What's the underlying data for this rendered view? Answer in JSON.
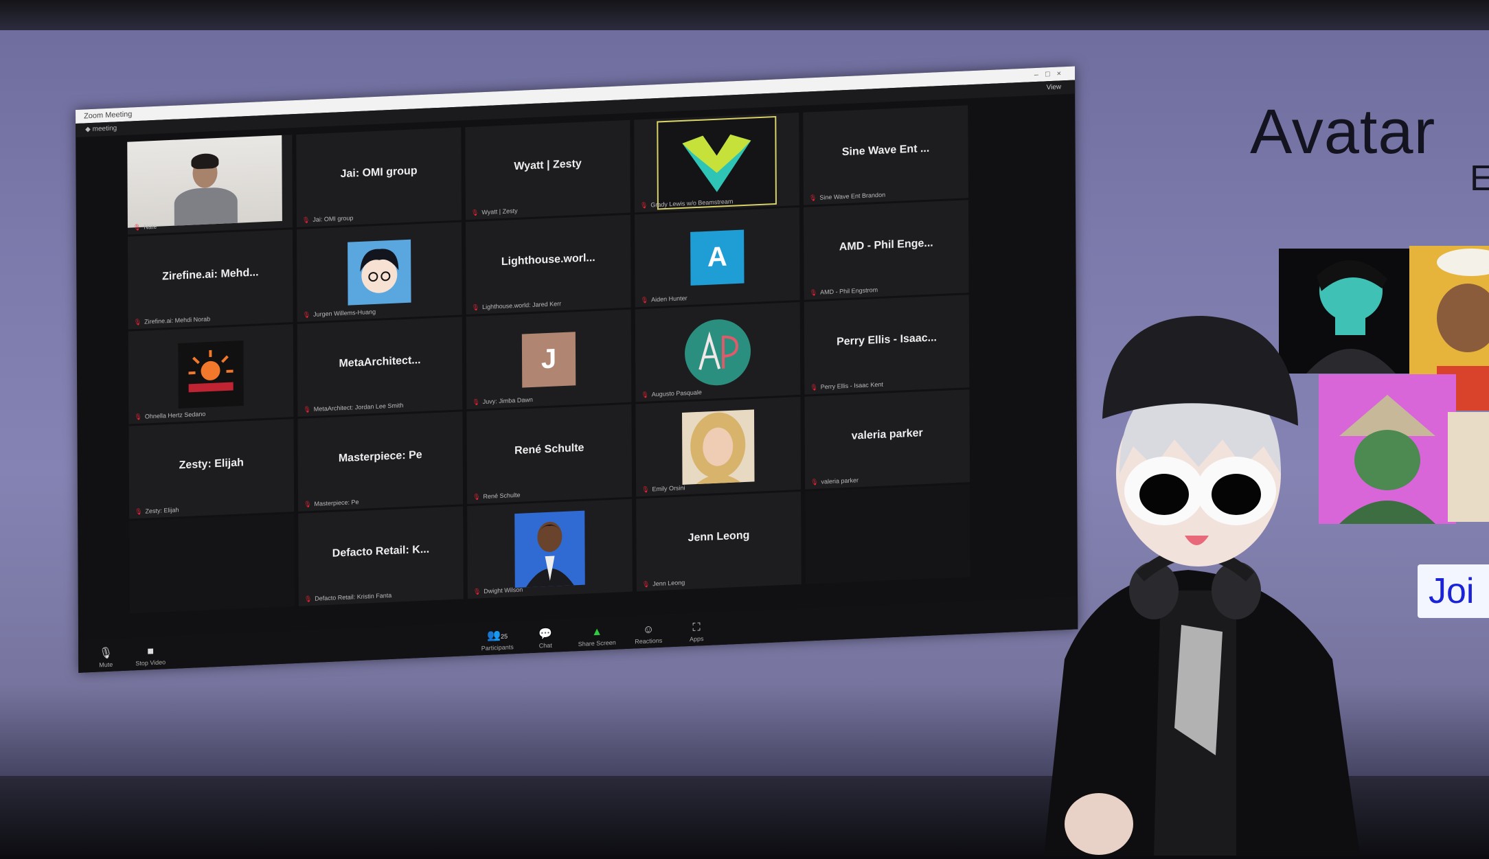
{
  "zoom": {
    "window_title": "Zoom Meeting",
    "sub_title": "meeting",
    "view_label": "View",
    "participants": [
      {
        "display": "video",
        "name": "",
        "label": "Nate"
      },
      {
        "display": "name",
        "name": "Jai: OMI group",
        "label": "Jai: OMI group"
      },
      {
        "display": "name",
        "name": "Wyatt | Zesty",
        "label": "Wyatt | Zesty"
      },
      {
        "display": "logo-m",
        "name": "",
        "label": "Grady Lewis w/o Beamstream"
      },
      {
        "display": "name",
        "name": "Sine Wave Ent ...",
        "label": "Sine Wave Ent Brandon"
      },
      {
        "display": "name",
        "name": "Zirefine.ai: Mehd...",
        "label": "Zirefine.ai: Mehdi Norab"
      },
      {
        "display": "anime",
        "name": "",
        "label": "Jurgen Willems-Huang"
      },
      {
        "display": "name",
        "name": "Lighthouse.worl...",
        "label": "Lighthouse.world: Jared Kerr"
      },
      {
        "display": "letter",
        "letter": "A",
        "name": "",
        "label": "Aiden Hunter"
      },
      {
        "display": "name",
        "name": "AMD - Phil Enge...",
        "label": "AMD - Phil Engstrom"
      },
      {
        "display": "logo-tandra",
        "name": "",
        "label": "Ohnella Hertz Sedano"
      },
      {
        "display": "name",
        "name": "MetaArchitect...",
        "label": "MetaArchitect: Jordan Lee Smith"
      },
      {
        "display": "letter",
        "letter": "J",
        "name": "",
        "label": "Juvy: Jimba Dawn"
      },
      {
        "display": "logo-ap",
        "name": "",
        "label": "Augusto Pasquale"
      },
      {
        "display": "name",
        "name": "Perry Ellis - Isaac...",
        "label": "Perry Ellis - Isaac Kent"
      },
      {
        "display": "name",
        "name": "Zesty: Elijah",
        "label": "Zesty: Elijah"
      },
      {
        "display": "name",
        "name": "Masterpiece: Pe",
        "label": "Masterpiece: Pe"
      },
      {
        "display": "name",
        "name": "René Schulte",
        "label": "René Schulte"
      },
      {
        "display": "photo-blonde",
        "name": "",
        "label": "Emily Orsini"
      },
      {
        "display": "name",
        "name": "valeria parker",
        "label": "valeria parker"
      },
      {
        "display": "empty",
        "name": "",
        "label": ""
      },
      {
        "display": "name",
        "name": "Defacto Retail: K...",
        "label": "Defacto Retail: Kristin Fanta"
      },
      {
        "display": "photo-woman",
        "name": "",
        "label": "Dwight Wilson"
      },
      {
        "display": "name",
        "name": "Jenn Leong",
        "label": "Jenn Leong"
      },
      {
        "display": "empty",
        "name": "",
        "label": ""
      }
    ],
    "toolbar": {
      "mute": "Mute",
      "video": "Stop Video",
      "participants": "Participants",
      "participant_count": "25",
      "chat": "Chat",
      "share": "Share Screen",
      "reactions": "Reactions",
      "apps": "Apps"
    }
  },
  "slide": {
    "title": "Avatar",
    "subtitle_fragment": "E",
    "join_button": "Joi"
  },
  "colors": {
    "wall": "#7c7aab",
    "zoom_bg": "#111114",
    "tile_bg": "#1d1d20",
    "letter_a": "#1f9ed6",
    "letter_j": "#b08673",
    "ap_logo": "#2a8f7e",
    "join_text": "#1a23d6"
  }
}
